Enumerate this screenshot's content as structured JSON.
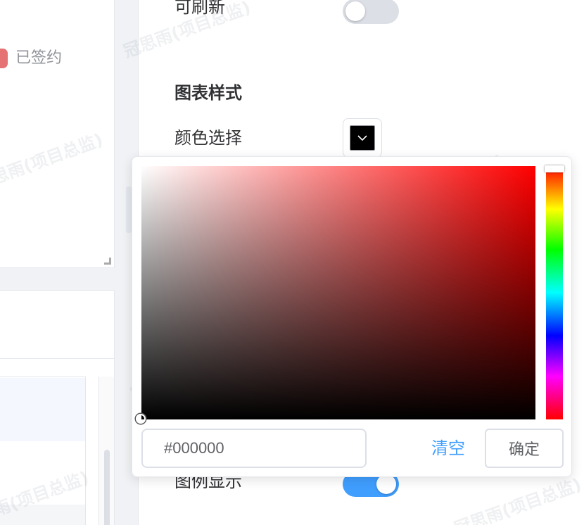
{
  "left_card": {
    "legend_label": "已签约",
    "legend_color": "#e57373"
  },
  "settings": {
    "refreshable_label": "可刷新",
    "refreshable_on": false,
    "chart_style_title": "图表样式",
    "color_select_label": "颜色选择",
    "selected_color": "#000000",
    "legend_show_label": "图例显示",
    "legend_show_on": true
  },
  "color_picker": {
    "hex_value": "#000000",
    "clear_label": "清空",
    "confirm_label": "确定",
    "hue_color": "#ff0000"
  },
  "watermark_text": "冠思雨(项目总监)",
  "colors": {
    "primary": "#409eff",
    "border": "#dcdfe6",
    "text": "#303133"
  }
}
